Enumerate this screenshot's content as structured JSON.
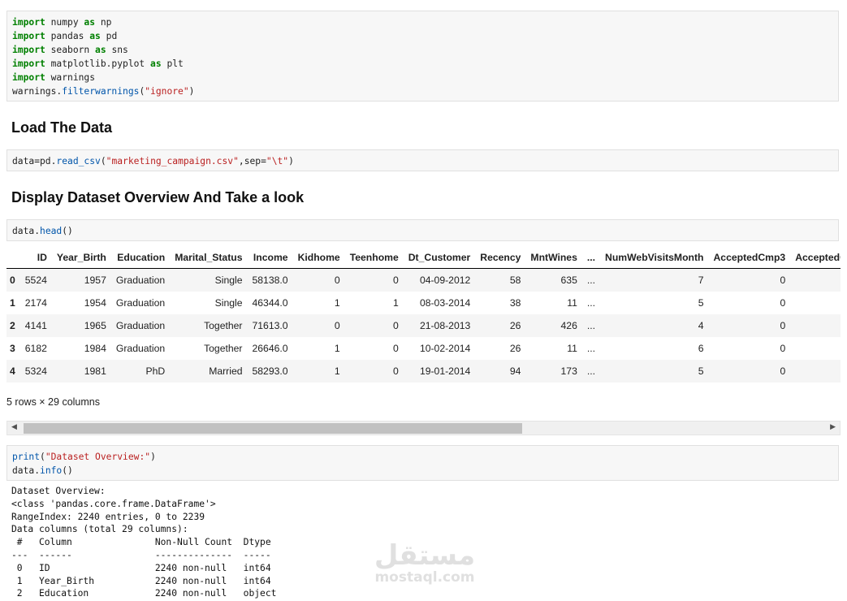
{
  "cells": {
    "imports": [
      {
        "kw": "import",
        "text": " numpy ",
        "kw2": "as",
        "tail": " np"
      },
      {
        "kw": "import",
        "text": " pandas ",
        "kw2": "as",
        "tail": " pd"
      },
      {
        "kw": "import",
        "text": " seaborn ",
        "kw2": "as",
        "tail": " sns"
      },
      {
        "kw": "import",
        "text": " matplotlib.pyplot ",
        "kw2": "as",
        "tail": " plt"
      },
      {
        "kw": "import",
        "text": " warnings",
        "kw2": "",
        "tail": ""
      }
    ],
    "filter_line": {
      "obj": "warnings.",
      "fn": "filterwarnings",
      "open": "(",
      "arg": "\"ignore\"",
      "close": ")"
    },
    "read_csv_line": {
      "pre": "data=pd.",
      "fn": "read_csv",
      "open": "(",
      "arg1": "\"marketing_campaign.csv\"",
      "mid": ",sep=",
      "arg2": "\"\\t\"",
      "close": ")"
    },
    "head_line": {
      "obj": "data.",
      "fn": "head",
      "call": "()"
    },
    "print_line": {
      "fn": "print",
      "open": "(",
      "arg": "\"Dataset Overview:\"",
      "close": ")"
    },
    "info_line": {
      "obj": "data.",
      "fn": "info",
      "call": "()"
    }
  },
  "headings": {
    "load": "Load The Data",
    "display": "Display Dataset Overview And Take a look"
  },
  "dataframe": {
    "columns": [
      "",
      "ID",
      "Year_Birth",
      "Education",
      "Marital_Status",
      "Income",
      "Kidhome",
      "Teenhome",
      "Dt_Customer",
      "Recency",
      "MntWines",
      "...",
      "NumWebVisitsMonth",
      "AcceptedCmp3",
      "AcceptedCm"
    ],
    "rows": [
      [
        "0",
        "5524",
        "1957",
        "Graduation",
        "Single",
        "58138.0",
        "0",
        "0",
        "04-09-2012",
        "58",
        "635",
        "...",
        "7",
        "0",
        ""
      ],
      [
        "1",
        "2174",
        "1954",
        "Graduation",
        "Single",
        "46344.0",
        "1",
        "1",
        "08-03-2014",
        "38",
        "11",
        "...",
        "5",
        "0",
        ""
      ],
      [
        "2",
        "4141",
        "1965",
        "Graduation",
        "Together",
        "71613.0",
        "0",
        "0",
        "21-08-2013",
        "26",
        "426",
        "...",
        "4",
        "0",
        ""
      ],
      [
        "3",
        "6182",
        "1984",
        "Graduation",
        "Together",
        "26646.0",
        "1",
        "0",
        "10-02-2014",
        "26",
        "11",
        "...",
        "6",
        "0",
        ""
      ],
      [
        "4",
        "5324",
        "1981",
        "PhD",
        "Married",
        "58293.0",
        "1",
        "0",
        "19-01-2014",
        "94",
        "173",
        "...",
        "5",
        "0",
        ""
      ]
    ],
    "shape_note": "5 rows × 29 columns"
  },
  "scrollbar": {
    "left_arrow": "◀",
    "right_arrow": "▶",
    "thumb_fraction": 0.6
  },
  "info_output": [
    "Dataset Overview:",
    "<class 'pandas.core.frame.DataFrame'>",
    "RangeIndex: 2240 entries, 0 to 2239",
    "Data columns (total 29 columns):",
    " #   Column               Non-Null Count  Dtype ",
    "---  ------               --------------  ----- ",
    " 0   ID                   2240 non-null   int64 ",
    " 1   Year_Birth           2240 non-null   int64 ",
    " 2   Education            2240 non-null   object"
  ],
  "watermark": {
    "logo": "مستقل",
    "site": "mostaql.com"
  }
}
